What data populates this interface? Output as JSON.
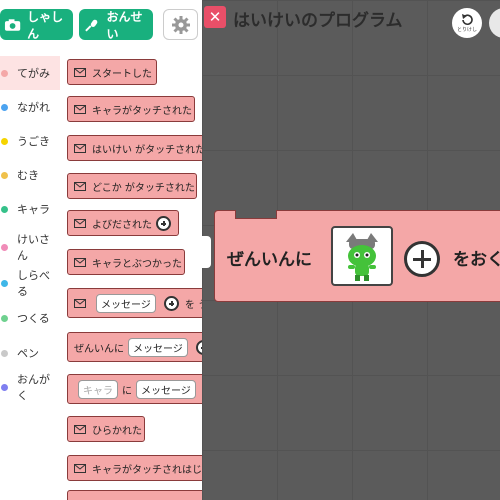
{
  "toolbar": {
    "photo_label": "しゃしん",
    "sound_label": "おんせい"
  },
  "categories": [
    {
      "label": "てがみ",
      "color": "#f4a7a7"
    },
    {
      "label": "ながれ",
      "color": "#4ca3f0"
    },
    {
      "label": "うごき",
      "color": "#f5d400"
    },
    {
      "label": "むき",
      "color": "#f0c14b"
    },
    {
      "label": "キャラ",
      "color": "#35c18a"
    },
    {
      "label": "けいさん",
      "color": "#f08cb8"
    },
    {
      "label": "しらべる",
      "color": "#3fb7e8"
    },
    {
      "label": "つくる",
      "color": "#6fd18f"
    },
    {
      "label": "ペン",
      "color": "#c9c9c9"
    },
    {
      "label": "おんがく",
      "color": "#7f7ff0"
    }
  ],
  "palette": {
    "b0": "スタートした",
    "b1": "キャラがタッチされた",
    "b2": "はいけい がタッチされた",
    "b3": "どこか がタッチされた",
    "b4": "よびだされた",
    "b5": "キャラとぶつかった",
    "b6_slot": "メッセージ",
    "b6_suffix": "を う",
    "b7_prefix": "ぜんいんに",
    "b7_slot": "メッセージ",
    "b8_slot1": "キャラ",
    "b8_mid": "に",
    "b8_slot2": "メッセージ",
    "b9": "ひらかれた",
    "b10": "キャラがタッチされはじ"
  },
  "workspace": {
    "title": "はいけいのプログラム",
    "undo_label": "とりけし",
    "block_prefix": "ぜんいんに",
    "block_suffix": "をおく"
  },
  "colors": {
    "accent": "#19b07e",
    "block": "#f4a7a7",
    "close": "#e94f68",
    "workspace_bg": "#5b5b5b"
  }
}
